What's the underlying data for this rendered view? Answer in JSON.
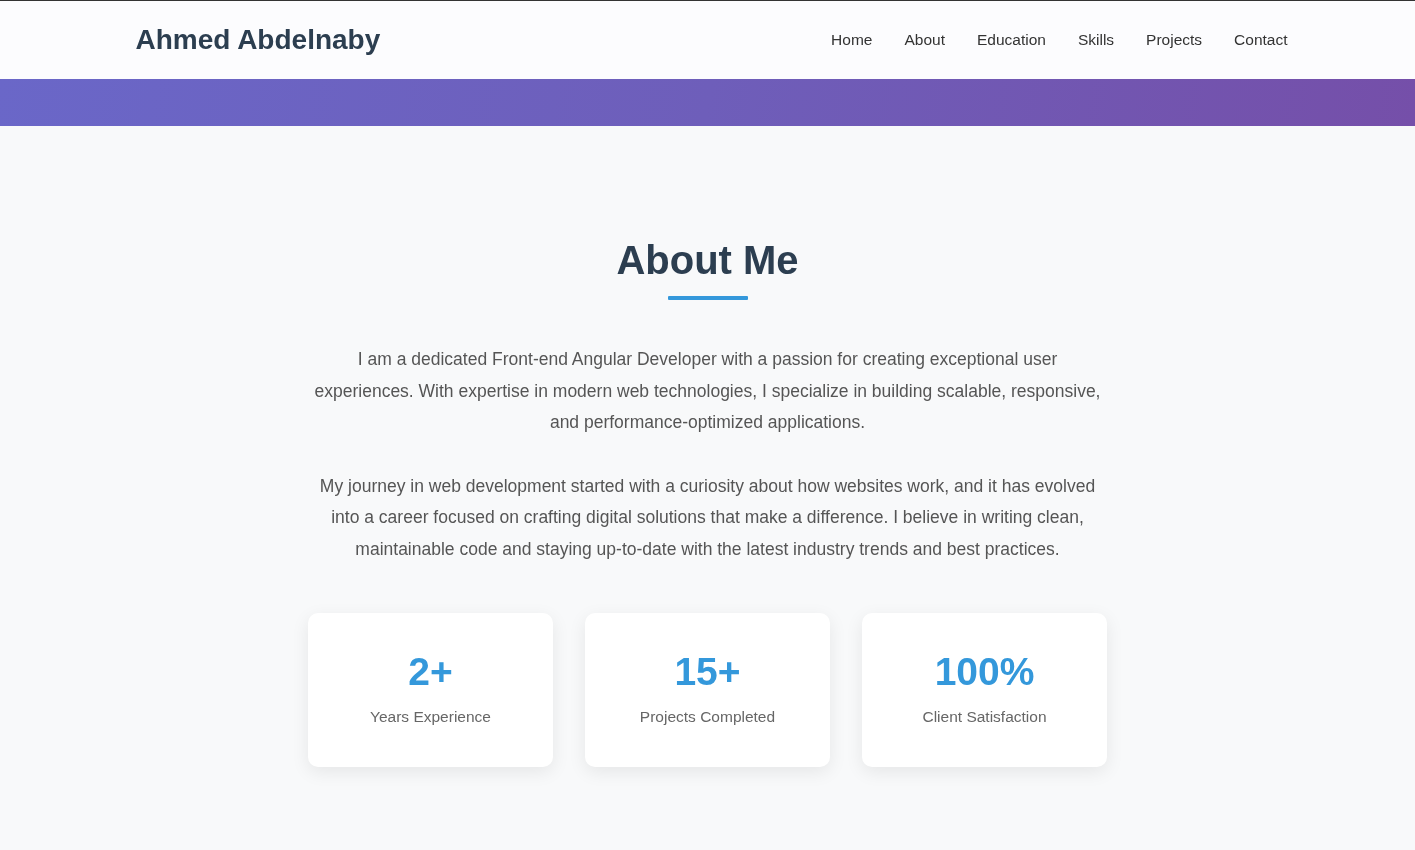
{
  "brand": "Ahmed Abdelnaby",
  "nav": [
    {
      "label": "Home"
    },
    {
      "label": "About"
    },
    {
      "label": "Education"
    },
    {
      "label": "Skills"
    },
    {
      "label": "Projects"
    },
    {
      "label": "Contact"
    }
  ],
  "about": {
    "title": "About Me",
    "paragraphs": [
      "I am a dedicated Front-end Angular Developer with a passion for creating exceptional user experiences. With expertise in modern web technologies, I specialize in building scalable, responsive, and performance-optimized applications.",
      "My journey in web development started with a curiosity about how websites work, and it has evolved into a career focused on crafting digital solutions that make a difference. I believe in writing clean, maintainable code and staying up-to-date with the latest industry trends and best practices."
    ],
    "stats": [
      {
        "value": "2+",
        "label": "Years Experience"
      },
      {
        "value": "15+",
        "label": "Projects Completed"
      },
      {
        "value": "100%",
        "label": "Client Satisfaction"
      }
    ]
  }
}
